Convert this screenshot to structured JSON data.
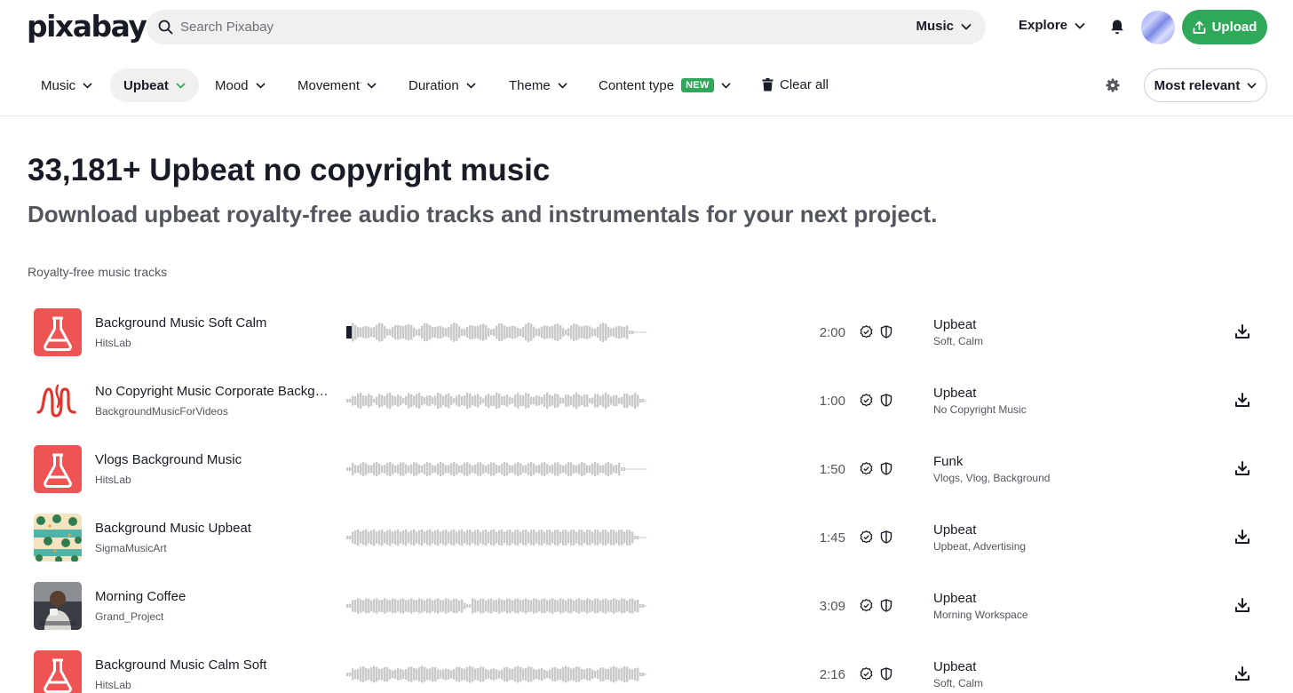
{
  "header": {
    "logo_text": "pixabay",
    "search_placeholder": "Search Pixabay",
    "search_scope": "Music",
    "explore_label": "Explore",
    "upload_label": "Upload",
    "brand_color": "#2fa85a"
  },
  "filters": [
    {
      "label": "Music",
      "active": false
    },
    {
      "label": "Upbeat",
      "active": true
    },
    {
      "label": "Mood",
      "active": false
    },
    {
      "label": "Movement",
      "active": false
    },
    {
      "label": "Duration",
      "active": false
    },
    {
      "label": "Theme",
      "active": false
    },
    {
      "label": "Content type",
      "active": false,
      "badge": "NEW"
    }
  ],
  "clear_all_label": "Clear all",
  "sort_label": "Most relevant",
  "page": {
    "title": "33,181+ Upbeat no copyright music",
    "subtitle": "Download upbeat royalty-free audio tracks and instrumentals for your next project.",
    "section_label": "Royalty-free music tracks"
  },
  "tracks": [
    {
      "title": "Background Music Soft Calm",
      "artist": "HitsLab",
      "duration": "2:00",
      "genre": "Upbeat",
      "tags": "Soft, Calm",
      "thumb": "flask-icon",
      "playing": true
    },
    {
      "title": "No Copyright Music Corporate Background",
      "artist": "BackgroundMusicForVideos",
      "duration": "1:00",
      "genre": "Upbeat",
      "tags": "No Copyright Music",
      "thumb": "m-logo-icon",
      "playing": false
    },
    {
      "title": "Vlogs Background Music",
      "artist": "HitsLab",
      "duration": "1:50",
      "genre": "Funk",
      "tags": "Vlogs, Vlog, Background",
      "thumb": "flask-icon",
      "playing": false
    },
    {
      "title": "Background Music Upbeat",
      "artist": "SigmaMusicArt",
      "duration": "1:45",
      "genre": "Upbeat",
      "tags": "Upbeat, Advertising",
      "thumb": "palm-pattern-image",
      "playing": false
    },
    {
      "title": "Morning Coffee",
      "artist": "Grand_Project",
      "duration": "3:09",
      "genre": "Upbeat",
      "tags": "Morning Workspace",
      "thumb": "coffee-photo-image",
      "playing": false
    },
    {
      "title": "Background Music Calm Soft",
      "artist": "HitsLab",
      "duration": "2:16",
      "genre": "Upbeat",
      "tags": "Soft, Calm",
      "thumb": "flask-icon",
      "playing": false
    }
  ]
}
